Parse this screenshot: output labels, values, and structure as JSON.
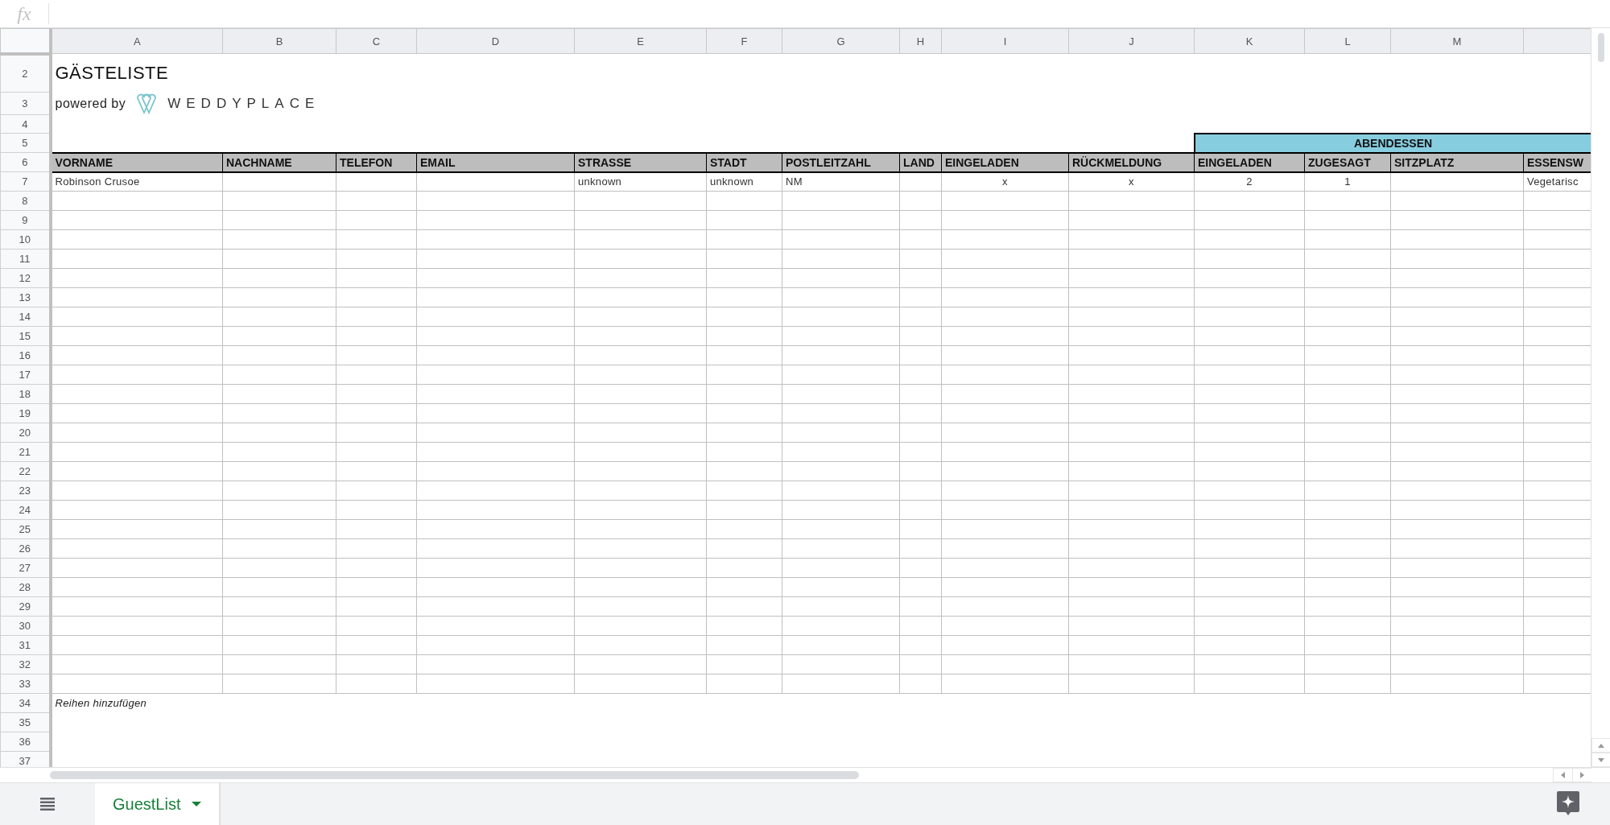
{
  "formula_bar": {
    "label": "fx"
  },
  "column_headers": [
    "A",
    "B",
    "C",
    "D",
    "E",
    "F",
    "G",
    "H",
    "I",
    "J",
    "K",
    "L",
    "M"
  ],
  "columns": [
    {
      "label": "VORNAME",
      "kind": "text"
    },
    {
      "label": "NACHNAME",
      "kind": "text"
    },
    {
      "label": "TELEFON",
      "kind": "text"
    },
    {
      "label": "EMAIL",
      "kind": "text"
    },
    {
      "label": "STRASSE",
      "kind": "text"
    },
    {
      "label": "STADT",
      "kind": "text"
    },
    {
      "label": "POSTLEITZAHL",
      "kind": "text"
    },
    {
      "label": "LAND",
      "kind": "text"
    },
    {
      "label": "EINGELADEN",
      "kind": "tally"
    },
    {
      "label": "RÜCKMELDUNG",
      "kind": "tally"
    },
    {
      "label": "EINGELADEN",
      "kind": "tally",
      "in_group": true
    },
    {
      "label": "ZUGESAGT",
      "kind": "tally",
      "in_group": true
    },
    {
      "label": "SITZPLATZ",
      "kind": "text",
      "in_group": true
    },
    {
      "label": "ESSENSW",
      "kind": "text",
      "in_group": true
    }
  ],
  "rows": [
    {
      "number": "2",
      "kind": "title",
      "text": "GÄSTELISTE"
    },
    {
      "number": "3",
      "kind": "brand",
      "text": "powered by",
      "logo": "WEDDYPLACE"
    },
    {
      "number": "4",
      "kind": "blank"
    },
    {
      "number": "5",
      "kind": "group",
      "label": "ABENDESSEN"
    },
    {
      "number": "6",
      "kind": "header"
    },
    {
      "number": "7",
      "kind": "data",
      "cells": [
        "Robinson Crusoe",
        null,
        null,
        null,
        "unknown",
        "unknown",
        "NM",
        null,
        "x",
        "x",
        "2",
        "1",
        null,
        "Vegetarisc"
      ]
    },
    {
      "number": "8",
      "kind": "empty"
    },
    {
      "number": "9",
      "kind": "empty"
    },
    {
      "number": "10",
      "kind": "empty"
    },
    {
      "number": "11",
      "kind": "empty"
    },
    {
      "number": "12",
      "kind": "empty"
    },
    {
      "number": "13",
      "kind": "empty"
    },
    {
      "number": "14",
      "kind": "empty"
    },
    {
      "number": "15",
      "kind": "empty"
    },
    {
      "number": "16",
      "kind": "empty"
    },
    {
      "number": "17",
      "kind": "empty"
    },
    {
      "number": "18",
      "kind": "empty"
    },
    {
      "number": "19",
      "kind": "empty"
    },
    {
      "number": "20",
      "kind": "empty"
    },
    {
      "number": "21",
      "kind": "empty"
    },
    {
      "number": "22",
      "kind": "empty"
    },
    {
      "number": "23",
      "kind": "empty"
    },
    {
      "number": "24",
      "kind": "empty"
    },
    {
      "number": "25",
      "kind": "empty"
    },
    {
      "number": "26",
      "kind": "empty"
    },
    {
      "number": "27",
      "kind": "empty"
    },
    {
      "number": "28",
      "kind": "empty"
    },
    {
      "number": "29",
      "kind": "empty"
    },
    {
      "number": "30",
      "kind": "empty"
    },
    {
      "number": "31",
      "kind": "empty"
    },
    {
      "number": "32",
      "kind": "empty"
    },
    {
      "number": "33",
      "kind": "empty"
    },
    {
      "number": "34",
      "kind": "note",
      "text": "Reihen hinzufügen"
    },
    {
      "number": "35",
      "kind": "blank"
    },
    {
      "number": "36",
      "kind": "blank"
    },
    {
      "number": "37",
      "kind": "blank"
    }
  ],
  "sheet_tabs": [
    {
      "label": "GuestList",
      "selected": true
    }
  ]
}
